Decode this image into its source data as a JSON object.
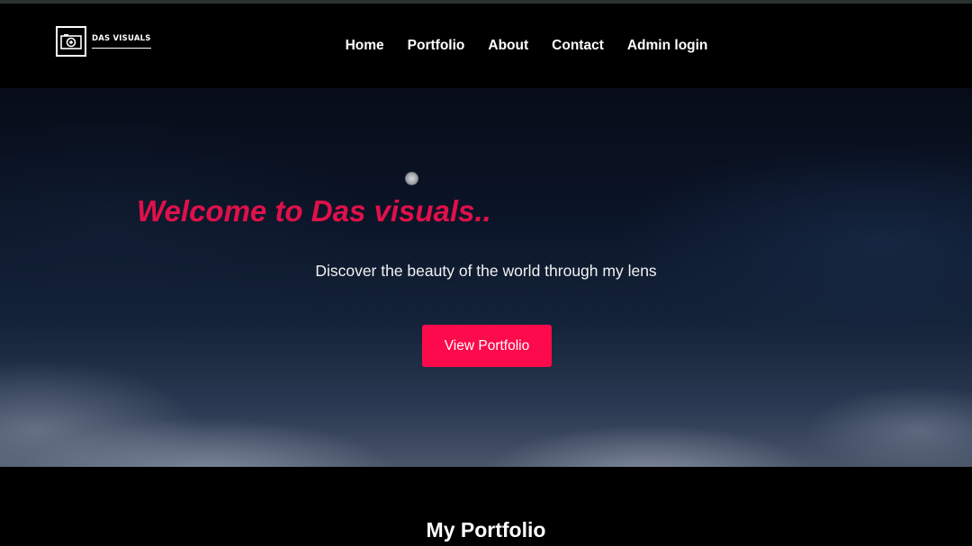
{
  "brand": {
    "name": "DAS VISUALS",
    "logo_icon": "camera-icon"
  },
  "nav": {
    "items": [
      {
        "label": "Home"
      },
      {
        "label": "Portfolio"
      },
      {
        "label": "About"
      },
      {
        "label": "Contact"
      },
      {
        "label": "Admin login"
      }
    ]
  },
  "hero": {
    "title": "Welcome to Das visuals..",
    "subtitle": "Discover the beauty of the world through my lens",
    "button_label": "View Portfolio"
  },
  "portfolio": {
    "heading": "My Portfolio"
  },
  "colors": {
    "accent": "#fd0a4c",
    "title": "#e0104a",
    "background": "#000000"
  }
}
